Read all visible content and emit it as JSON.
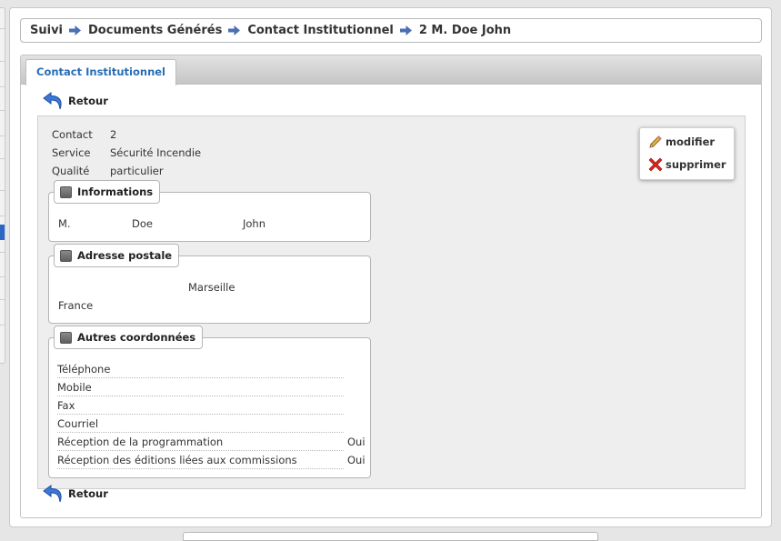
{
  "breadcrumb": {
    "items": [
      "Suivi",
      "Documents Générés",
      "Contact Institutionnel",
      "2 M. Doe John"
    ]
  },
  "tab": {
    "label": "Contact Institutionnel"
  },
  "back_label": "Retour",
  "summary": [
    {
      "label": "Contact",
      "value": "2"
    },
    {
      "label": "Service",
      "value": "Sécurité Incendie"
    },
    {
      "label": "Qualité",
      "value": "particulier"
    }
  ],
  "informations": {
    "legend": "Informations",
    "civilite": "M.",
    "nom": "Doe",
    "prenom": "John"
  },
  "adresse": {
    "legend": "Adresse postale",
    "ville": "Marseille",
    "pays": "France"
  },
  "coordonnees": {
    "legend": "Autres coordonnées",
    "rows": [
      {
        "label": "Téléphone",
        "value": ""
      },
      {
        "label": "Mobile",
        "value": ""
      },
      {
        "label": "Fax",
        "value": ""
      },
      {
        "label": "Courriel",
        "value": ""
      },
      {
        "label": "Réception de la programmation",
        "value": "Oui"
      },
      {
        "label": "Réception des éditions liées aux commissions",
        "value": "Oui"
      }
    ]
  },
  "actions": {
    "modifier": "modifier",
    "supprimer": "supprimer"
  },
  "colors": {
    "accent": "#2a6db5",
    "arrow": "#4a6fb3",
    "delete": "#d9261c"
  }
}
